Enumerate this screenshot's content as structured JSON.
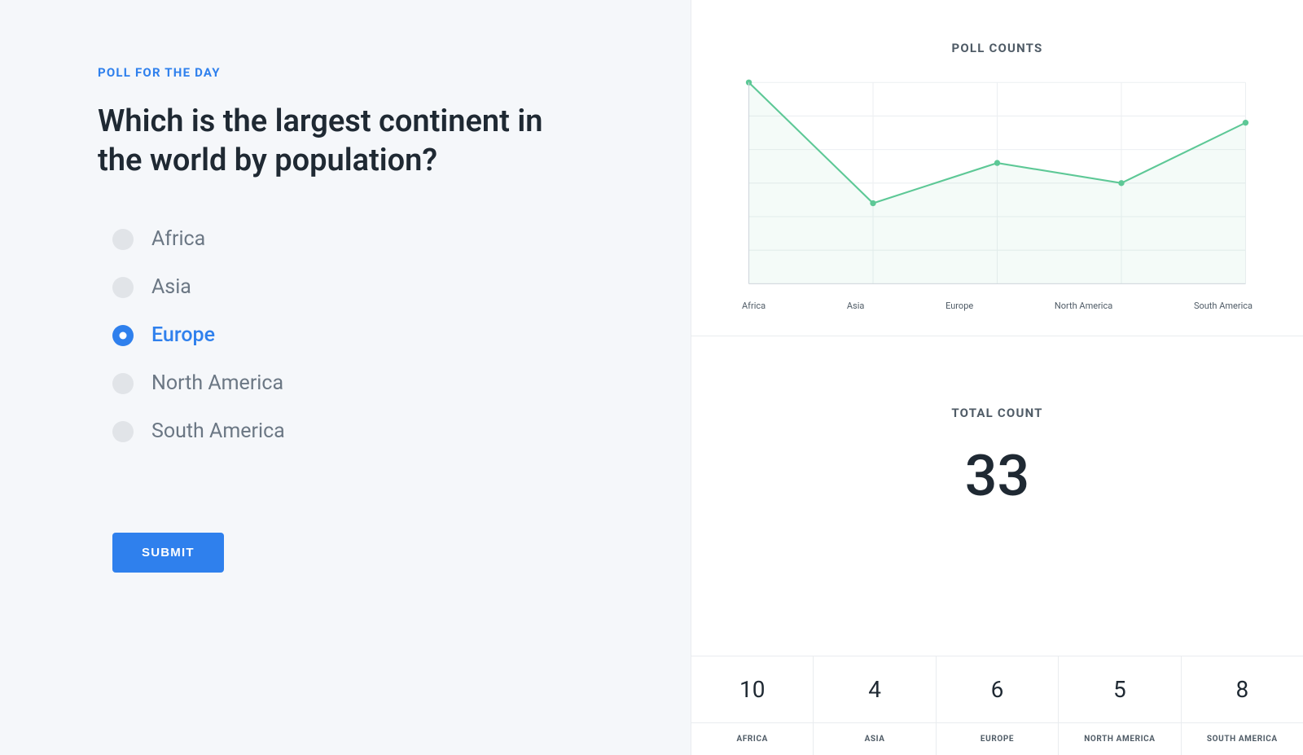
{
  "poll": {
    "kicker": "POLL FOR THE DAY",
    "question": "Which is the largest continent in the world by population?",
    "options": [
      "Africa",
      "Asia",
      "Europe",
      "North America",
      "South America"
    ],
    "selected_index": 2,
    "submit_label": "SUBMIT"
  },
  "chart_data": {
    "type": "line",
    "title": "POLL COUNTS",
    "categories": [
      "Africa",
      "Asia",
      "Europe",
      "North America",
      "South America"
    ],
    "values": [
      10,
      4,
      6,
      5,
      8
    ],
    "ylim": [
      0,
      10
    ],
    "xlabel": "",
    "ylabel": ""
  },
  "totals": {
    "title": "TOTAL COUNT",
    "total": "33",
    "breakdown": {
      "labels": [
        "AFRICA",
        "ASIA",
        "EUROPE",
        "NORTH AMERICA",
        "SOUTH AMERICA"
      ],
      "values": [
        "10",
        "4",
        "6",
        "5",
        "8"
      ]
    }
  }
}
